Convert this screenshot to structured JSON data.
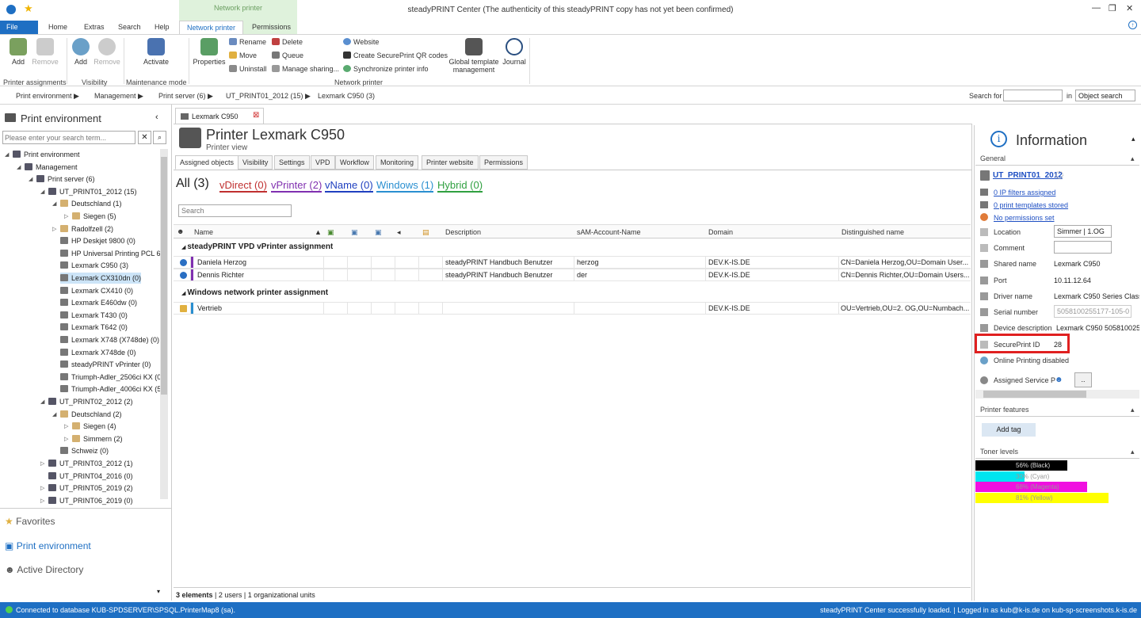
{
  "window": {
    "title": "steadyPRINT Center (The authenticity of this steadyPRINT copy has not yet been confirmed)",
    "controls": [
      "—",
      "❐",
      "✕"
    ]
  },
  "context_tab": {
    "label": "Network printer"
  },
  "tabs": [
    "Home",
    "Extras",
    "Search",
    "Help"
  ],
  "file_tab": "File",
  "active_tab": "Network printer",
  "permissions_tab": "Permissions",
  "ribbon": {
    "add": "Add",
    "remove": "Remove",
    "vis_add": "Add",
    "vis_remove": "Remove",
    "activate": "Activate",
    "properties": "Properties",
    "rename": "Rename",
    "move": "Move",
    "uninstall": "Uninstall",
    "delete": "Delete",
    "queue": "Queue",
    "manage_sharing": "Manage sharing...",
    "website": "Website",
    "create_qr": "Create SecurePrint QR codes",
    "sync": "Synchronize printer info",
    "global_template": "Global template management",
    "journal": "Journal",
    "groups": [
      "Printer assignments",
      "Visibility",
      "Maintenance mode",
      "Network printer"
    ]
  },
  "breadcrumb": {
    "items": [
      "Print environment",
      "Management",
      "Print server (6)",
      "UT_PRINT01_2012 (15)",
      "Lexmark C950 (3)"
    ],
    "search_for": "Search for",
    "in": "in",
    "search_scope": "Object search"
  },
  "left": {
    "title": "Print environment",
    "search_placeholder": "Please enter your search term...",
    "tree": [
      {
        "label": "Print environment",
        "level": 0,
        "exp": "◢"
      },
      {
        "label": "Management",
        "level": 1,
        "exp": "◢"
      },
      {
        "label": "Print server (6)",
        "level": 2,
        "exp": "◢"
      },
      {
        "label": "UT_PRINT01_2012 (15)",
        "level": 3,
        "exp": "◢"
      },
      {
        "label": "Deutschland (1)",
        "level": 4,
        "exp": "◢"
      },
      {
        "label": "Siegen (5)",
        "level": 5,
        "exp": "▷"
      },
      {
        "label": "Radolfzell (2)",
        "level": 4,
        "exp": "▷"
      },
      {
        "label": "HP Deskjet 9800 (0)",
        "level": 4,
        "exp": ""
      },
      {
        "label": "HP Universal Printing PCL 6",
        "level": 4,
        "exp": ""
      },
      {
        "label": "Lexmark C950 (3)",
        "level": 4,
        "exp": ""
      },
      {
        "label": "Lexmark CX310dn (0)",
        "level": 4,
        "exp": "",
        "sel": true
      },
      {
        "label": "Lexmark CX410 (0)",
        "level": 4,
        "exp": ""
      },
      {
        "label": "Lexmark E460dw (0)",
        "level": 4,
        "exp": ""
      },
      {
        "label": "Lexmark T430 (0)",
        "level": 4,
        "exp": ""
      },
      {
        "label": "Lexmark T642 (0)",
        "level": 4,
        "exp": ""
      },
      {
        "label": "Lexmark X748 (X748de) (0)",
        "level": 4,
        "exp": ""
      },
      {
        "label": "Lexmark X748de (0)",
        "level": 4,
        "exp": ""
      },
      {
        "label": "steadyPRINT vPrinter (0)",
        "level": 4,
        "exp": ""
      },
      {
        "label": "Triumph-Adler_2506ci KX (0",
        "level": 4,
        "exp": ""
      },
      {
        "label": "Triumph-Adler_4006ci KX (5",
        "level": 4,
        "exp": ""
      },
      {
        "label": "UT_PRINT02_2012 (2)",
        "level": 3,
        "exp": "◢"
      },
      {
        "label": "Deutschland (2)",
        "level": 4,
        "exp": "◢"
      },
      {
        "label": "Siegen (4)",
        "level": 5,
        "exp": "▷"
      },
      {
        "label": "Simmern (2)",
        "level": 5,
        "exp": "▷"
      },
      {
        "label": "Schweiz (0)",
        "level": 4,
        "exp": ""
      },
      {
        "label": "UT_PRINT03_2012 (1)",
        "level": 3,
        "exp": "▷"
      },
      {
        "label": "UT_PRINT04_2016 (0)",
        "level": 3,
        "exp": ""
      },
      {
        "label": "UT_PRINT05_2019 (2)",
        "level": 3,
        "exp": "▷"
      },
      {
        "label": "UT_PRINT06_2019 (0)",
        "level": 3,
        "exp": "▷"
      }
    ],
    "nav": [
      "Favorites",
      "Print environment",
      "Active Directory"
    ]
  },
  "doc_tab": "Lexmark C950",
  "header": {
    "title": "Printer Lexmark C950",
    "subtitle": "Printer view"
  },
  "subtabs": [
    "Assigned objects",
    "Visibility",
    "Settings",
    "VPD",
    "Workflow",
    "Monitoring",
    "Printer website",
    "Permissions"
  ],
  "filters": {
    "all": "All (3)",
    "vdirect": "vDirect (0)",
    "vprinter": "vPrinter (2)",
    "vname": "vName (0)",
    "windows": "Windows (1)",
    "hybrid": "Hybrid (0)"
  },
  "grid_search_placeholder": "Search",
  "columns": [
    "Name",
    "Description",
    "sAM-Account-Name",
    "Domain",
    "Distinguished name"
  ],
  "groups": [
    {
      "title": "steadyPRINT VPD vPrinter assignment",
      "rows": [
        {
          "name": "Daniela Herzog",
          "desc": "steadyPRINT Handbuch Benutzer",
          "sam": "herzog",
          "domain": "DEV.K-IS.DE",
          "dn": "CN=Daniela Herzog,OU=Domain User..."
        },
        {
          "name": "Dennis Richter",
          "desc": "steadyPRINT Handbuch Benutzer",
          "sam": "der",
          "domain": "DEV.K-IS.DE",
          "dn": "CN=Dennis Richter,OU=Domain Users..."
        }
      ]
    },
    {
      "title": "Windows network printer assignment",
      "rows": [
        {
          "name": "Vertrieb",
          "desc": "",
          "sam": "",
          "domain": "DEV.K-IS.DE",
          "dn": "OU=Vertrieb,OU=2. OG,OU=Numbach..."
        }
      ]
    }
  ],
  "footer": {
    "count": "3 elements",
    "detail": "| 2 users | 1 organizational units"
  },
  "info": {
    "title": "Information",
    "general": "General",
    "server": "UT_PRINT01_2012",
    "ip_filters": "0 IP filters assigned",
    "templates": "0 print templates stored",
    "permissions": "No permissions set",
    "fields": [
      {
        "label": "Location",
        "value": "Simmer | 1.OG"
      },
      {
        "label": "Comment",
        "value": ""
      },
      {
        "label": "Shared name",
        "value": "Lexmark C950"
      },
      {
        "label": "Port",
        "value": "10.11.12.64"
      },
      {
        "label": "Driver name",
        "value": "Lexmark C950 Series Class I"
      },
      {
        "label": "Serial number",
        "value": "5058100255177-105-0"
      },
      {
        "label": "Device description",
        "value": "Lexmark C950 505810025"
      },
      {
        "label": "SecurePrint ID",
        "value": "28"
      }
    ],
    "online": "Online Printing disabled",
    "assigned": "Assigned Service P",
    "dots": "..",
    "features": "Printer features",
    "add_tag": "Add tag",
    "toner": "Toner levels",
    "toner_levels": [
      {
        "label": "56% (Black)",
        "pct": 56,
        "color": "#000000"
      },
      {
        "label": "30% (Cyan)",
        "pct": 30,
        "color": "#00e5f0"
      },
      {
        "label": "68% (Magenta)",
        "pct": 68,
        "color": "#f010e0"
      },
      {
        "label": "81% (Yellow)",
        "pct": 81,
        "color": "#ffff00"
      }
    ]
  },
  "status": {
    "left": "Connected to database KUB-SPDSERVER\\SPSQL.PrinterMap8 (sa).",
    "right": "steadyPRINT Center successfully loaded. | Logged in as kub@k-is.de on kub-sp-screenshots.k-is.de"
  }
}
